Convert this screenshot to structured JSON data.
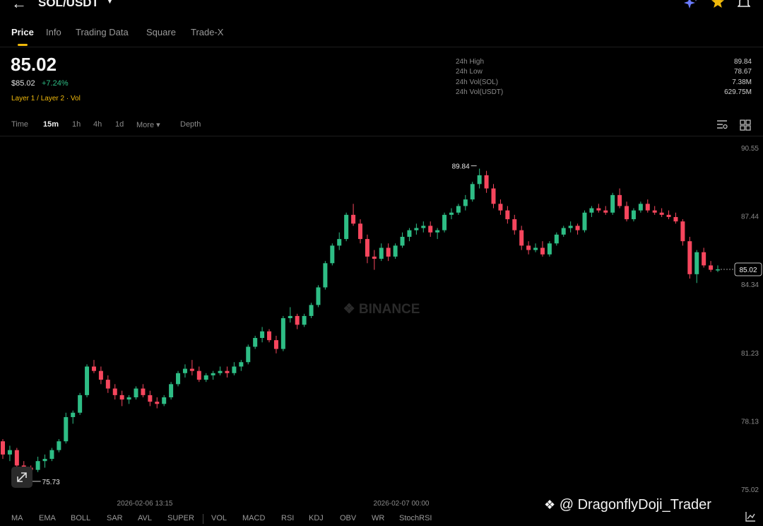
{
  "header": {
    "pair": "SOL/USDT",
    "icons": [
      "back-arrow-icon",
      "caret-down-icon",
      "ai-sparkle-icon",
      "star-icon",
      "bell-icon"
    ]
  },
  "tabs": [
    "Price",
    "Info",
    "Trading Data",
    "Square",
    "Trade-X"
  ],
  "price": {
    "last": "85.02",
    "fiat": "$85.02",
    "change": "+7.24%",
    "tags": "Layer 1 / Layer 2 · Vol"
  },
  "stats": [
    {
      "label": "24h High",
      "value": "89.84"
    },
    {
      "label": "24h Low",
      "value": "78.67"
    },
    {
      "label": "24h Vol(SOL)",
      "value": "7.38M"
    },
    {
      "label": "24h Vol(USDT)",
      "value": "629.75M"
    }
  ],
  "intervals": [
    "Time",
    "15m",
    "1h",
    "4h",
    "1d",
    "More ▾",
    "Depth"
  ],
  "indicators": [
    "MA",
    "EMA",
    "BOLL",
    "SAR",
    "AVL",
    "SUPER",
    "VOL",
    "MACD",
    "RSI",
    "KDJ",
    "OBV",
    "WR",
    "StochRSI"
  ],
  "watermark": {
    "exchange": "BINANCE",
    "handle": "@ DragonflyDoji_Trader"
  },
  "colors": {
    "up": "#2ebd85",
    "down": "#f6465d",
    "accent": "#f0b90b",
    "background": "#000000"
  },
  "chart_data": {
    "type": "candlestick",
    "interval": "15m",
    "y_ticks": [
      "90.55",
      "87.44",
      "84.34",
      "81.23",
      "78.13",
      "75.02"
    ],
    "ylim": [
      75.02,
      90.55
    ],
    "x_ticks": [
      "2026-02-06 13:15",
      "2026-02-07 00:00"
    ],
    "high_label": "89.84",
    "low_label": "75.73",
    "last_price_label": "85.02",
    "candles": [
      [
        77.2,
        77.3,
        76.4,
        76.6
      ],
      [
        76.6,
        77.0,
        76.3,
        76.8
      ],
      [
        76.8,
        76.9,
        75.9,
        76.1
      ],
      [
        76.1,
        76.3,
        75.8,
        76.0
      ],
      [
        76.0,
        76.1,
        75.7,
        75.9
      ],
      [
        75.9,
        76.5,
        75.8,
        76.3
      ],
      [
        76.3,
        76.6,
        76.0,
        76.4
      ],
      [
        76.4,
        76.9,
        76.3,
        76.8
      ],
      [
        76.8,
        77.3,
        76.7,
        77.2
      ],
      [
        77.2,
        78.5,
        77.1,
        78.3
      ],
      [
        78.3,
        78.6,
        78.0,
        78.5
      ],
      [
        78.5,
        79.4,
        78.4,
        79.3
      ],
      [
        79.3,
        80.7,
        79.2,
        80.6
      ],
      [
        80.6,
        80.9,
        80.3,
        80.4
      ],
      [
        80.4,
        80.6,
        79.8,
        80.0
      ],
      [
        80.0,
        80.2,
        79.4,
        79.6
      ],
      [
        79.6,
        79.8,
        79.1,
        79.3
      ],
      [
        79.3,
        79.5,
        78.8,
        79.1
      ],
      [
        79.1,
        79.3,
        78.9,
        79.2
      ],
      [
        79.2,
        79.7,
        79.1,
        79.6
      ],
      [
        79.6,
        79.8,
        79.2,
        79.3
      ],
      [
        79.3,
        79.5,
        78.8,
        79.0
      ],
      [
        79.0,
        79.2,
        78.7,
        78.9
      ],
      [
        78.9,
        79.3,
        78.8,
        79.2
      ],
      [
        79.2,
        79.9,
        79.1,
        79.8
      ],
      [
        79.8,
        80.4,
        79.7,
        80.3
      ],
      [
        80.3,
        80.7,
        80.1,
        80.5
      ],
      [
        80.5,
        80.9,
        80.2,
        80.4
      ],
      [
        80.4,
        80.6,
        79.9,
        80.0
      ],
      [
        80.0,
        80.3,
        79.9,
        80.2
      ],
      [
        80.2,
        80.4,
        80.0,
        80.3
      ],
      [
        80.3,
        80.6,
        80.2,
        80.4
      ],
      [
        80.4,
        80.6,
        80.1,
        80.3
      ],
      [
        80.3,
        80.8,
        80.2,
        80.6
      ],
      [
        80.6,
        80.9,
        80.4,
        80.8
      ],
      [
        80.8,
        81.6,
        80.7,
        81.5
      ],
      [
        81.5,
        82.0,
        81.4,
        81.9
      ],
      [
        81.9,
        82.4,
        81.7,
        82.2
      ],
      [
        82.2,
        82.3,
        81.7,
        81.8
      ],
      [
        81.8,
        82.0,
        81.2,
        81.4
      ],
      [
        81.4,
        82.9,
        81.3,
        82.8
      ],
      [
        82.8,
        83.3,
        82.6,
        82.9
      ],
      [
        82.9,
        83.0,
        82.3,
        82.5
      ],
      [
        82.5,
        83.0,
        82.4,
        82.9
      ],
      [
        82.9,
        83.5,
        82.8,
        83.4
      ],
      [
        83.4,
        84.3,
        83.3,
        84.2
      ],
      [
        84.2,
        85.4,
        84.1,
        85.3
      ],
      [
        85.3,
        86.2,
        85.2,
        86.1
      ],
      [
        86.1,
        86.7,
        85.9,
        86.4
      ],
      [
        86.4,
        87.6,
        86.3,
        87.5
      ],
      [
        87.5,
        88.0,
        87.0,
        87.1
      ],
      [
        87.1,
        87.3,
        86.2,
        86.4
      ],
      [
        86.4,
        86.6,
        85.3,
        85.6
      ],
      [
        85.6,
        85.9,
        85.0,
        85.5
      ],
      [
        85.5,
        86.2,
        85.4,
        86.0
      ],
      [
        86.0,
        86.2,
        85.4,
        85.6
      ],
      [
        85.6,
        86.2,
        85.5,
        86.1
      ],
      [
        86.1,
        86.7,
        86.0,
        86.5
      ],
      [
        86.5,
        86.9,
        86.3,
        86.8
      ],
      [
        86.8,
        87.1,
        86.6,
        86.9
      ],
      [
        86.9,
        87.2,
        86.7,
        87.0
      ],
      [
        87.0,
        87.2,
        86.5,
        86.7
      ],
      [
        86.7,
        86.9,
        86.4,
        86.8
      ],
      [
        86.8,
        87.6,
        86.7,
        87.5
      ],
      [
        87.5,
        87.8,
        87.3,
        87.6
      ],
      [
        87.6,
        88.0,
        87.5,
        87.9
      ],
      [
        87.9,
        88.4,
        87.7,
        88.2
      ],
      [
        88.2,
        89.0,
        88.1,
        88.9
      ],
      [
        88.9,
        89.6,
        88.7,
        89.3
      ],
      [
        89.3,
        89.5,
        88.5,
        88.7
      ],
      [
        88.7,
        88.9,
        87.8,
        88.0
      ],
      [
        88.0,
        88.2,
        87.5,
        87.7
      ],
      [
        87.7,
        87.9,
        87.1,
        87.3
      ],
      [
        87.3,
        87.5,
        86.6,
        86.8
      ],
      [
        86.8,
        87.0,
        85.9,
        86.1
      ],
      [
        86.1,
        86.3,
        85.7,
        85.9
      ],
      [
        85.9,
        86.2,
        85.8,
        86.0
      ],
      [
        86.0,
        86.3,
        85.6,
        85.7
      ],
      [
        85.7,
        86.3,
        85.6,
        86.2
      ],
      [
        86.2,
        86.7,
        86.1,
        86.6
      ],
      [
        86.6,
        87.0,
        86.5,
        86.9
      ],
      [
        86.9,
        87.2,
        86.7,
        87.0
      ],
      [
        87.0,
        87.1,
        86.6,
        86.8
      ],
      [
        86.8,
        87.7,
        86.7,
        87.6
      ],
      [
        87.6,
        87.9,
        87.4,
        87.8
      ],
      [
        87.8,
        88.0,
        87.6,
        87.7
      ],
      [
        87.7,
        87.9,
        87.5,
        87.6
      ],
      [
        87.6,
        88.5,
        87.5,
        88.4
      ],
      [
        88.4,
        88.7,
        87.8,
        87.9
      ],
      [
        87.9,
        88.1,
        87.2,
        87.3
      ],
      [
        87.3,
        87.8,
        87.2,
        87.7
      ],
      [
        87.7,
        88.1,
        87.6,
        88.0
      ],
      [
        88.0,
        88.2,
        87.6,
        87.7
      ],
      [
        87.7,
        87.9,
        87.5,
        87.6
      ],
      [
        87.6,
        87.8,
        87.4,
        87.5
      ],
      [
        87.5,
        87.7,
        87.3,
        87.4
      ],
      [
        87.4,
        87.6,
        87.1,
        87.2
      ],
      [
        87.2,
        87.3,
        86.1,
        86.3
      ],
      [
        86.3,
        86.5,
        84.6,
        84.8
      ],
      [
        84.8,
        85.9,
        84.4,
        85.8
      ],
      [
        85.8,
        86.0,
        85.1,
        85.2
      ],
      [
        85.2,
        85.4,
        84.9,
        85.0
      ],
      [
        85.0,
        85.2,
        84.9,
        85.02
      ]
    ]
  }
}
